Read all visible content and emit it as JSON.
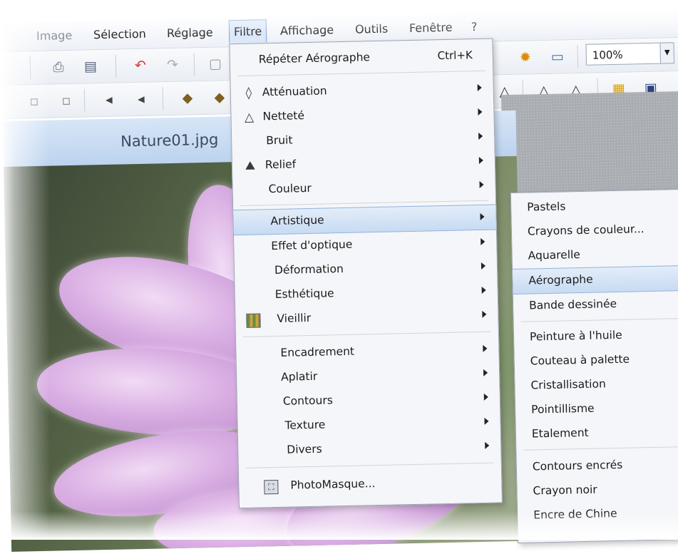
{
  "menubar": {
    "items": [
      {
        "label": "Image",
        "faded": true
      },
      {
        "label": "Sélection"
      },
      {
        "label": "Réglage"
      },
      {
        "label": "Filtre",
        "active": true
      },
      {
        "label": "Affichage"
      },
      {
        "label": "Outils"
      },
      {
        "label": "Fenêtre"
      },
      {
        "label": "?"
      }
    ]
  },
  "toolbar": {
    "zoom_value": "100%"
  },
  "document": {
    "title": "Nature01.jpg"
  },
  "filtre_menu": {
    "repeat": {
      "label": "Répéter Aérographe",
      "shortcut": "Ctrl+K"
    },
    "group1": [
      {
        "label": "Atténuation",
        "icon": "drop-icon",
        "submenu": true
      },
      {
        "label": "Netteté",
        "icon": "sharpen-icon",
        "submenu": true
      },
      {
        "label": "Bruit",
        "icon": "",
        "submenu": true
      },
      {
        "label": "Relief",
        "icon": "relief-icon",
        "submenu": true
      },
      {
        "label": "Couleur",
        "icon": "",
        "submenu": true
      }
    ],
    "group2": [
      {
        "label": "Artistique",
        "submenu": true,
        "highlighted": true
      },
      {
        "label": "Effet d'optique",
        "submenu": true
      },
      {
        "label": "Déformation",
        "submenu": true
      },
      {
        "label": "Esthétique",
        "submenu": true
      },
      {
        "label": "Vieillir",
        "submenu": true,
        "icon": "vieillir-icon"
      }
    ],
    "group3": [
      {
        "label": "Encadrement",
        "submenu": true
      },
      {
        "label": "Aplatir",
        "submenu": true
      },
      {
        "label": "Contours",
        "submenu": true
      },
      {
        "label": "Texture",
        "submenu": true
      },
      {
        "label": "Divers",
        "submenu": true
      }
    ],
    "photomasque": {
      "label": "PhotoMasque...",
      "icon": "photomasque-icon"
    }
  },
  "artistique_submenu": {
    "group1": [
      "Pastels",
      "Crayons de couleur...",
      "Aquarelle",
      "Aérographe",
      "Bande dessinée"
    ],
    "highlighted": "Aérographe",
    "group2": [
      "Peinture à l'huile",
      "Couteau à palette",
      "Cristallisation",
      "Pointillisme",
      "Etalement"
    ],
    "group3": [
      "Contours encrés",
      "Crayon noir",
      "Encre de Chine"
    ]
  },
  "colors": {
    "menu_bg": "#f5f6f9",
    "highlight": "#c7dbf3",
    "highlight_border": "#8fb1db",
    "title_bar": "#c9dcf2"
  }
}
